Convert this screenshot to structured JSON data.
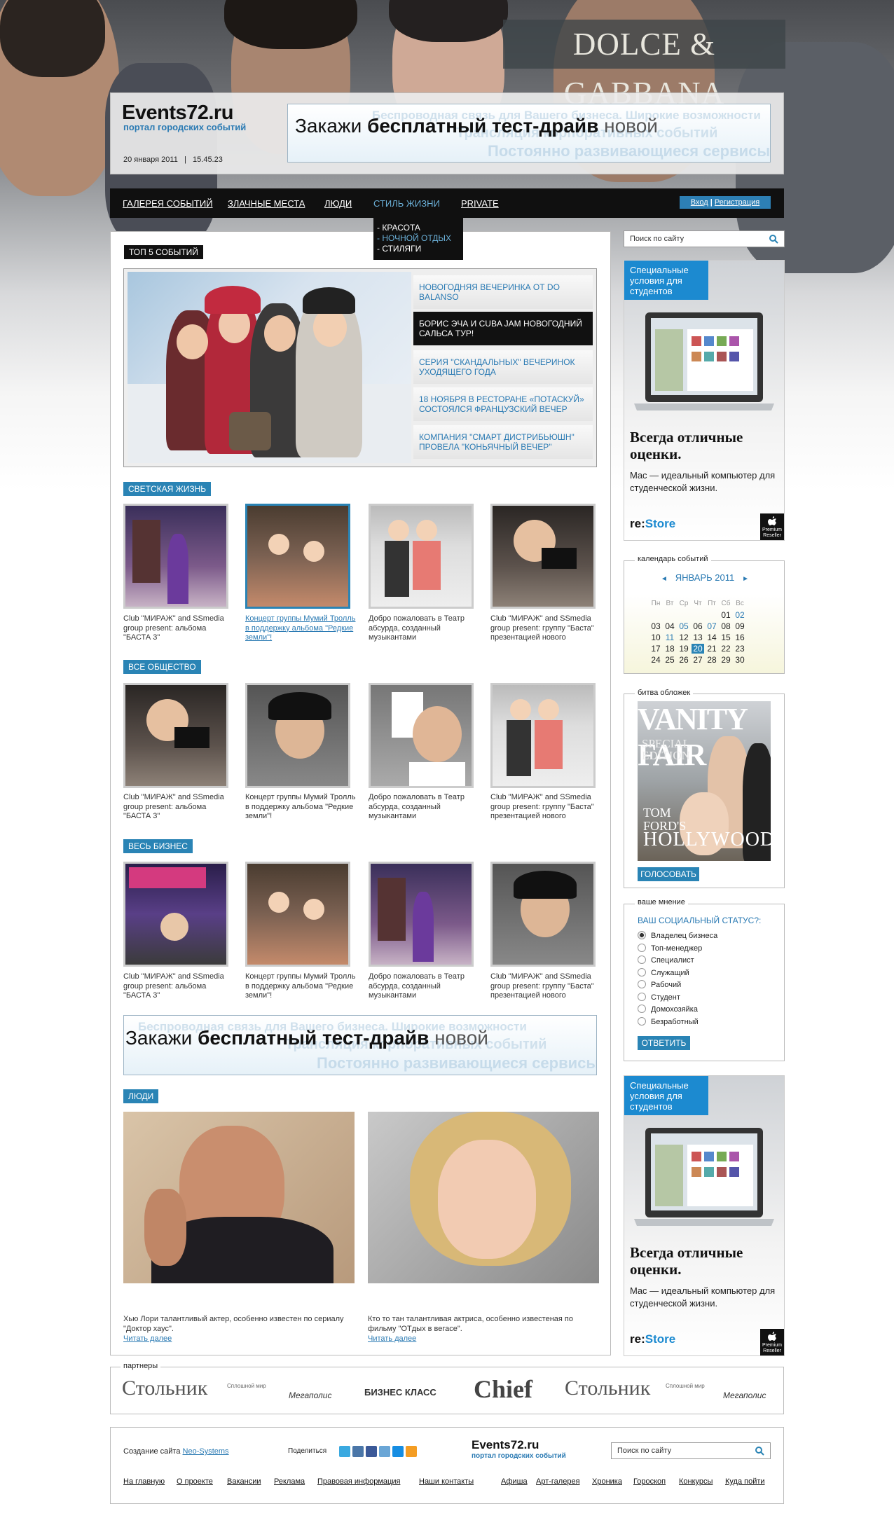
{
  "hero": {
    "brand_banner": "DOLCE & GABBANA"
  },
  "header": {
    "logo": "Events72.ru",
    "tagline": "портал городских событий",
    "date": "20 января 2011",
    "separator": "|",
    "time": "15.45.23"
  },
  "banner": {
    "text_light": "Закажи ",
    "text_bold": "бесплатный тест-драйв",
    "text_end": " новой",
    "ghost1": "Беспроводная связь для Вашего бизнеса. Широкие возможности",
    "ghost2": "Трансляция корпоративных событий",
    "ghost3": "Постоянно развивающиеся сервисы"
  },
  "nav": {
    "items": [
      "ГАЛЕРЕЯ СОБЫТИЙ",
      "ЗЛАЧНЫЕ МЕСТА",
      "ЛЮДИ",
      "СТИЛЬ ЖИЗНИ",
      "PRIVATE"
    ],
    "login": "Вход",
    "sep": "|",
    "register": "Регистрация",
    "dropdown": [
      "- КРАСОТА",
      "- НОЧНОЙ ОТДЫХ",
      "- СТИЛЯГИ"
    ]
  },
  "top5": {
    "heading": "ТОП 5 СОБЫТИЙ",
    "items": [
      "НОВОГОДНЯЯ ВЕЧЕРИНКА ОТ DO BALANSO",
      "БОРИС ЭЧА И CUBA JAM НОВОГОДНИЙ САЛЬСА ТУР!",
      "СЕРИЯ \"СКАНДАЛЬНЫХ\" ВЕЧЕРИНОК УХОДЯЩЕГО ГОДА",
      "18 НОЯБРЯ В РЕСТОРАНЕ «ПОТАСКУЙ» СОСТОЯЛСЯ ФРАНЦУЗСКИЙ ВЕЧЕР",
      "КОМПАНИЯ \"СМАРТ ДИСТРИБЬЮШН\" ПРОВЕЛА \"КОНЬЯЧНЫЙ ВЕЧЕР\""
    ]
  },
  "sections": [
    {
      "title": "СВЕТСКАЯ ЖИЗНЬ",
      "captions": [
        "Club \"МИРАЖ\" and SSmedia group present: альбома \"БАСТА 3\"",
        "Концерт группы Мумий Тролль в поддержку альбома \"Редкие земли\"!",
        "Добро пожаловать в Театр абсурда, созданный музыкантами",
        "Club \"МИРАЖ\" and SSmedia group present: группу \"Баста\" презентацией нового"
      ]
    },
    {
      "title": "ВСЕ ОБЩЕСТВО",
      "captions": [
        "Club \"МИРАЖ\" and SSmedia group present: альбома \"БАСТА 3\"",
        "Концерт группы Мумий Тролль в поддержку альбома \"Редкие земли\"!",
        "Добро пожаловать в Театр абсурда, созданный музыкантами",
        "Club \"МИРАЖ\" and SSmedia group present: группу \"Баста\" презентацией нового"
      ]
    },
    {
      "title": "ВЕСЬ БИЗНЕС",
      "captions": [
        "Club \"МИРАЖ\" and SSmedia group present: альбома \"БАСТА 3\"",
        "Концерт группы Мумий Тролль в поддержку альбома \"Редкие земли\"!",
        "Добро пожаловать в Театр абсурда, созданный музыкантами",
        "Club \"МИРАЖ\" and SSmedia group present: группу \"Баста\" презентацией нового"
      ]
    }
  ],
  "people": {
    "title": "ЛЮДИ",
    "items": [
      {
        "text": "Хью Лори талантливый актер, особенно известен по сериалу \"Доктор хаус\".",
        "more": "Читать далее"
      },
      {
        "text": "Кто то тан талантливая актриса, особенно известеная по фильму \"ОТдых в вегасе\".",
        "more": "Читать далее"
      }
    ]
  },
  "search": {
    "placeholder": "Поиск по сайту"
  },
  "ad": {
    "badge": "Специальные условия для студентов",
    "headline": "Всегда отличные оценки.",
    "text": "Mac — идеальный компьютер для студенческой жизни.",
    "brand1": "re:",
    "brand2": "Store",
    "apple_badge": "Premium Reseller"
  },
  "calendar": {
    "title": "календарь событий",
    "prev": "◄",
    "month": "ЯНВАРЬ 2011",
    "next": "►",
    "weekdays": [
      "Пн",
      "Вт",
      "Ср",
      "Чт",
      "Пт",
      "Сб",
      "Вс"
    ],
    "days": [
      "",
      "",
      "",
      "",
      "",
      "01",
      "02",
      "03",
      "04",
      "05",
      "06",
      "07",
      "08",
      "09",
      "10",
      "11",
      "12",
      "13",
      "14",
      "15",
      "16",
      "17",
      "18",
      "19",
      "20",
      "21",
      "22",
      "23",
      "24",
      "25",
      "26",
      "27",
      "28",
      "29",
      "30"
    ],
    "linked_days": [
      "02",
      "05",
      "07",
      "11",
      "20"
    ],
    "today": "20"
  },
  "covers": {
    "title": "битва обложек",
    "magazine": "VANITY FAIR",
    "edition": "SPECIAL EDITION",
    "cover_line1": "TOM",
    "cover_line2": "FORD'S",
    "cover_line3": "HOLLYWOOD",
    "vote": "ГОЛОСОВАТЬ"
  },
  "poll": {
    "title": "ваше мнение",
    "question": "ВАШ СОЦИАЛЬНЫЙ СТАТУС?:",
    "options": [
      "Владелец бизнеса",
      "Топ-менеджер",
      "Специалист",
      "Служащий",
      "Рабочий",
      "Студент",
      "Домохозяйка",
      "Безработный"
    ],
    "selected": 0,
    "submit": "ОТВЕТИТЬ"
  },
  "partners": {
    "title": "партнеры",
    "logos": [
      "Стольник",
      "Сплошной мир",
      "Мегаполис",
      "БИЗНЕС КЛАСС",
      "Chief",
      "Стольник",
      "Сплошной мир",
      "Мегаполис"
    ]
  },
  "footer": {
    "made_by": "Создание сайта ",
    "made_by_link": "Neo-Systems",
    "share": "Поделиться",
    "logo": "Events72.ru",
    "tagline": "портал городских событий",
    "search_placeholder": "Поиск по сайту",
    "links_left": [
      "На главную",
      "О проекте",
      "Вакансии",
      "Реклама",
      "Правовая информация",
      "Наши контакты"
    ],
    "links_right": [
      "Афиша",
      "Арт-галерея",
      "Хроника",
      "Гороскоп",
      "Конкурсы",
      "Куда пойти"
    ]
  },
  "colors": {
    "accent": "#2a84b5",
    "nav_bg": "#101010",
    "link": "#2a7ab3"
  }
}
